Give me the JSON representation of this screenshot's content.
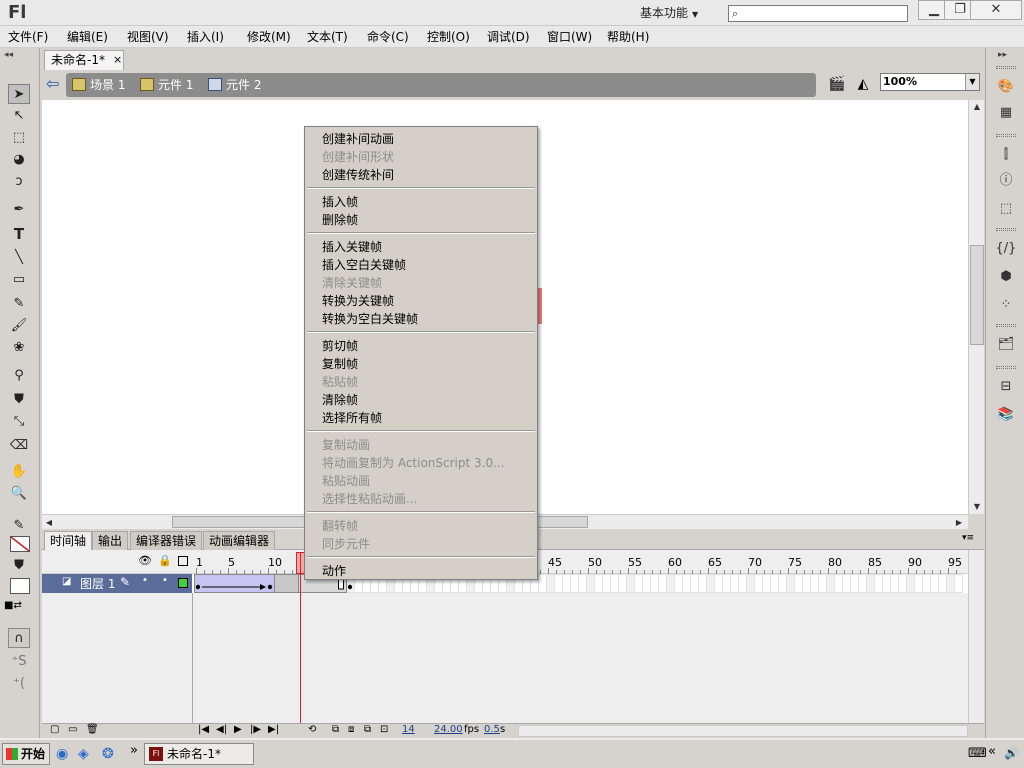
{
  "app": {
    "logo": "Fl",
    "workspace": "基本功能"
  },
  "menu": [
    "文件(F)",
    "编辑(E)",
    "视图(V)",
    "插入(I)",
    "修改(M)",
    "文本(T)",
    "命令(C)",
    "控制(O)",
    "调试(D)",
    "窗口(W)",
    "帮助(H)"
  ],
  "document": {
    "tab": "未命名-1*",
    "tab_close": "×"
  },
  "breadcrumb": [
    {
      "label": "场景 1",
      "icon": "scene-icon"
    },
    {
      "label": "元件 1",
      "icon": "symbol-icon"
    },
    {
      "label": "元件 2",
      "icon": "symbol-icon"
    }
  ],
  "zoom": "100%",
  "context_menu": [
    {
      "label": "创建补间动画",
      "enabled": true
    },
    {
      "label": "创建补间形状",
      "enabled": false
    },
    {
      "label": "创建传统补间",
      "enabled": true
    },
    {
      "sep": true
    },
    {
      "label": "插入帧",
      "enabled": true
    },
    {
      "label": "删除帧",
      "enabled": true
    },
    {
      "sep": true
    },
    {
      "label": "插入关键帧",
      "enabled": true
    },
    {
      "label": "插入空白关键帧",
      "enabled": true
    },
    {
      "label": "清除关键帧",
      "enabled": false
    },
    {
      "label": "转换为关键帧",
      "enabled": true
    },
    {
      "label": "转换为空白关键帧",
      "enabled": true
    },
    {
      "sep": true
    },
    {
      "label": "剪切帧",
      "enabled": true
    },
    {
      "label": "复制帧",
      "enabled": true
    },
    {
      "label": "粘贴帧",
      "enabled": false
    },
    {
      "label": "清除帧",
      "enabled": true
    },
    {
      "label": "选择所有帧",
      "enabled": true
    },
    {
      "sep": true
    },
    {
      "label": "复制动画",
      "enabled": false
    },
    {
      "label": "将动画复制为 ActionScript 3.0...",
      "enabled": false
    },
    {
      "label": "粘贴动画",
      "enabled": false
    },
    {
      "label": "选择性粘贴动画...",
      "enabled": false
    },
    {
      "sep": true
    },
    {
      "label": "翻转帧",
      "enabled": false
    },
    {
      "label": "同步元件",
      "enabled": false
    },
    {
      "sep": true
    },
    {
      "label": "动作",
      "enabled": true
    }
  ],
  "timeline": {
    "tabs": [
      "时间轴",
      "输出",
      "编译器错误",
      "动画编辑器"
    ],
    "frame_numbers": [
      "1",
      "5",
      "10",
      "45",
      "50",
      "55",
      "60",
      "65",
      "70",
      "75",
      "80",
      "85",
      "90",
      "95"
    ],
    "layer_name": "图层 1",
    "current_frame": "14",
    "fps": "24.00",
    "fps_unit": "fps",
    "time": "0.5",
    "time_unit": "s"
  },
  "taskbar": {
    "start": "开始",
    "window": "未命名-1*",
    "chevron": "»"
  }
}
